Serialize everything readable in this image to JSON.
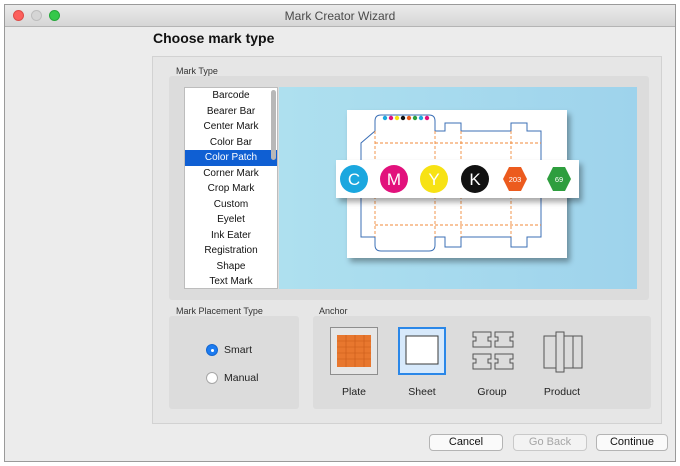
{
  "window": {
    "title": "Mark Creator Wizard"
  },
  "page": {
    "title": "Choose mark type"
  },
  "mark_type": {
    "label": "Mark Type",
    "items": [
      "Barcode",
      "Bearer Bar",
      "Center Mark",
      "Color Bar",
      "Color Patch",
      "Corner Mark",
      "Crop Mark",
      "Custom",
      "Eyelet",
      "Ink Eater",
      "Registration",
      "Shape",
      "Text Mark"
    ],
    "selected": "Color Patch"
  },
  "preview": {
    "patches": [
      {
        "label": "C",
        "color": "#1ba7df",
        "shape": "circle"
      },
      {
        "label": "M",
        "color": "#e2117c",
        "shape": "circle"
      },
      {
        "label": "Y",
        "color": "#f7e214",
        "shape": "circle"
      },
      {
        "label": "K",
        "color": "#111111",
        "shape": "circle"
      },
      {
        "label": "203",
        "color": "#ec5b1e",
        "shape": "hexagon"
      },
      {
        "label": "69",
        "color": "#2e9e3e",
        "shape": "hexagon"
      }
    ]
  },
  "placement": {
    "label": "Mark Placement Type",
    "options": [
      {
        "label": "Smart",
        "checked": true
      },
      {
        "label": "Manual",
        "checked": false
      }
    ]
  },
  "anchor": {
    "label": "Anchor",
    "items": [
      {
        "label": "Plate",
        "selected": false
      },
      {
        "label": "Sheet",
        "selected": true
      },
      {
        "label": "Group",
        "selected": false
      },
      {
        "label": "Product",
        "selected": false
      }
    ]
  },
  "buttons": {
    "cancel": "Cancel",
    "back": "Go Back",
    "continue": "Continue"
  },
  "colors": {
    "accent": "#0f5fd3",
    "plate_fill": "#e8772e",
    "dieline_blue": "#3b6fb6",
    "dieline_orange": "#f08a3a"
  }
}
